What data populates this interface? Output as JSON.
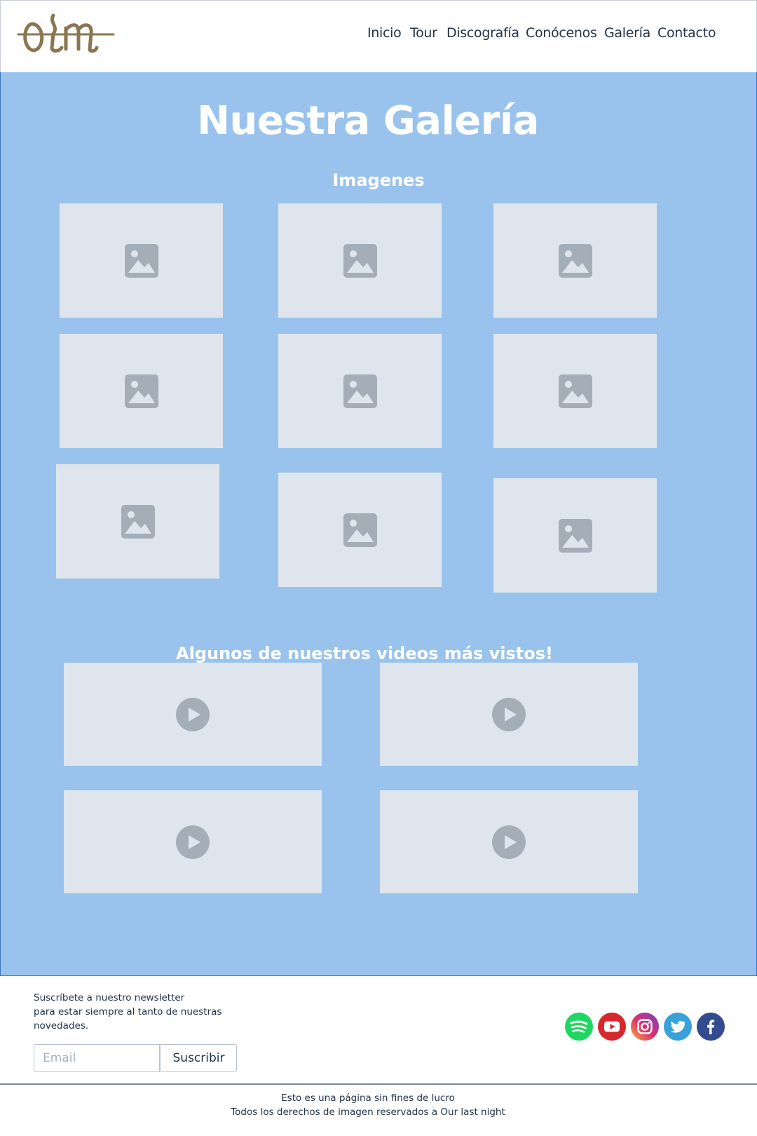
{
  "header": {
    "logo_text": "OLN",
    "nav": [
      "Inicio",
      "Tour",
      "Discografía",
      "Conócenos",
      "Galería",
      "Contacto"
    ]
  },
  "main": {
    "title": "Nuestra Galería",
    "images_heading": "Imagenes",
    "videos_heading": "Algunos de nuestros videos más vistos!",
    "image_count": 9,
    "video_count": 4
  },
  "footer": {
    "newsletter_text": "Suscríbete a nuestro newsletter para estar siempre al tanto de nuestras novedades.",
    "newsletter_lines": [
      "Suscríbete a nuestro newsletter",
      "para estar siempre al tanto de nuestras",
      "novedades."
    ],
    "email_placeholder": "Email",
    "subscribe_label": "Suscribir",
    "social": [
      "spotify-icon",
      "youtube-icon",
      "instagram-icon",
      "twitter-icon",
      "facebook-icon"
    ],
    "legal_line1": "Esto es una página  sin fines de lucro",
    "legal_line2": "Todos los derechos de imagen reservados a Our last night"
  },
  "colors": {
    "main_bg": "#99c3ec",
    "placeholder_bg": "#dfe5ed",
    "placeholder_icon": "#a3aeb9",
    "logo": "#8a7650",
    "spotify": "#1ed760",
    "youtube": "#d8262d",
    "twitter": "#38a1da",
    "facebook": "#334b8f"
  }
}
